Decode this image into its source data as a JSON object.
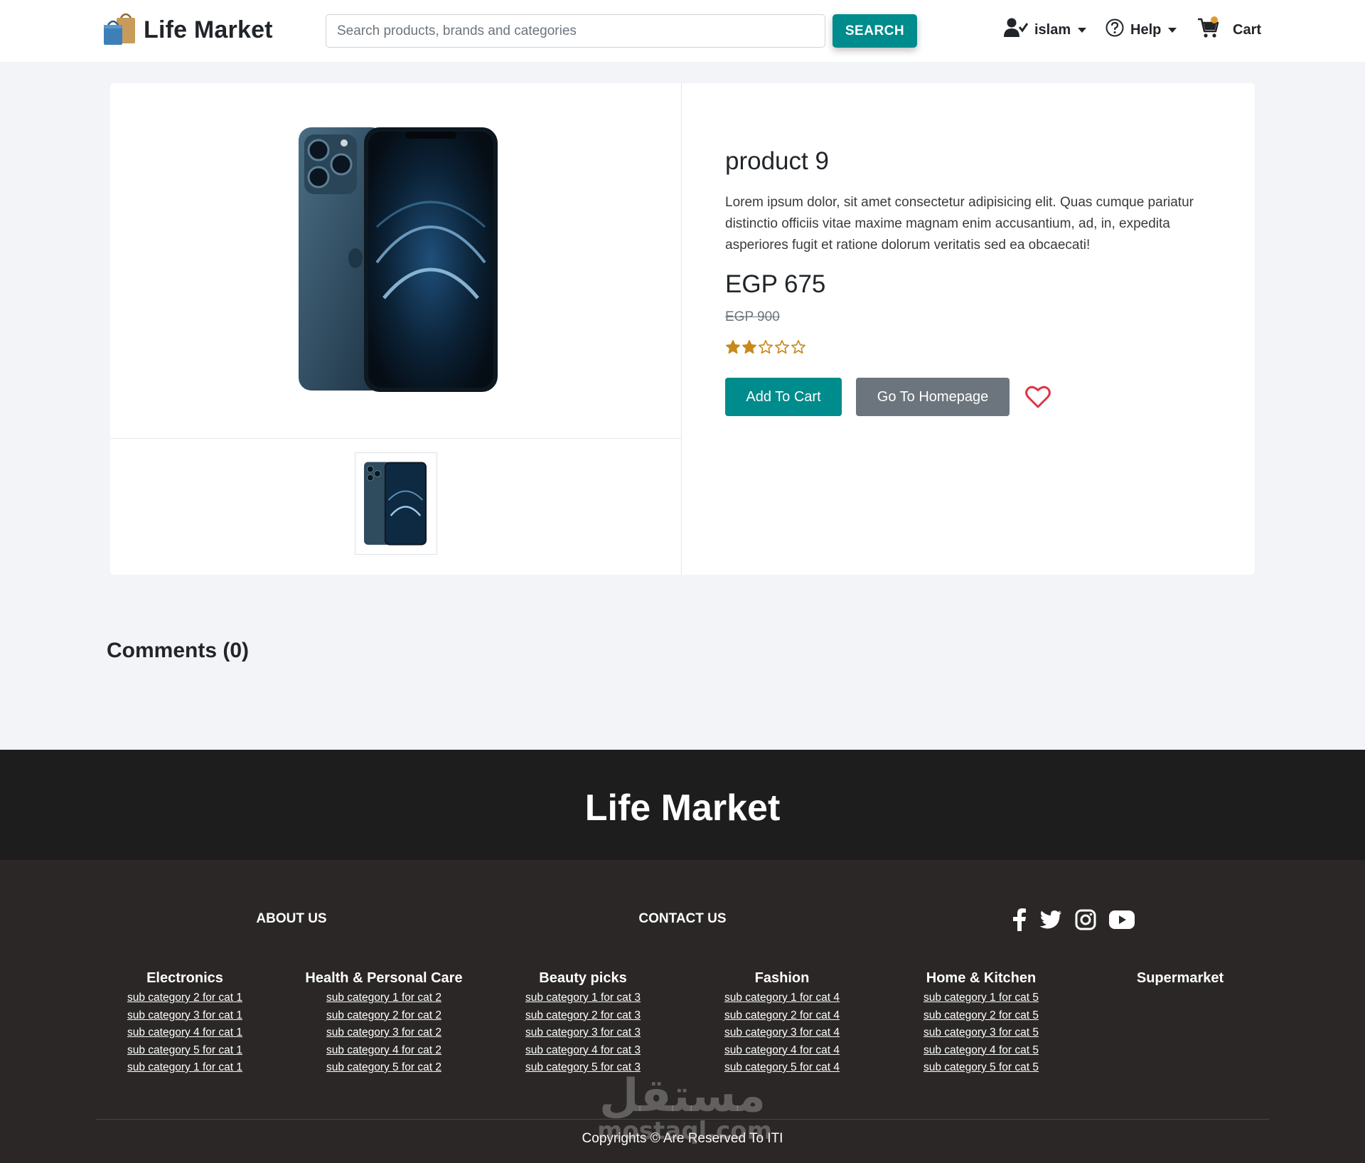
{
  "header": {
    "brand": "Life Market",
    "search_placeholder": "Search products, brands and categories",
    "search_button": "SEARCH",
    "user_name": "islam",
    "help_label": "Help",
    "cart_label": "Cart"
  },
  "product": {
    "title": "product 9",
    "description": "Lorem ipsum dolor, sit amet consectetur adipisicing elit. Quas cumque pariatur distinctio officiis vitae maxime magnam enim accusantium, ad, in, expedita asperiores fugit et ratione dolorum veritatis sed ea obcaecati!",
    "price": "EGP 675",
    "old_price": "EGP 900",
    "rating": 2,
    "rating_max": 5,
    "add_to_cart": "Add To Cart",
    "go_home": "Go To Homepage"
  },
  "comments": {
    "title": "Comments (0)"
  },
  "footer": {
    "brand": "Life Market",
    "about": "ABOUT US",
    "contact": "CONTACT US",
    "socials": [
      "facebook-icon",
      "twitter-icon",
      "instagram-icon",
      "youtube-icon"
    ],
    "categories": [
      {
        "title": "Electronics",
        "subs": [
          "sub category 2 for cat 1",
          "sub category 3 for cat 1",
          "sub category 4 for cat 1",
          "sub category 5 for cat 1",
          "sub category 1 for cat 1"
        ]
      },
      {
        "title": "Health & Personal Care",
        "subs": [
          "sub category 1 for cat 2",
          "sub category 2 for cat 2",
          "sub category 3 for cat 2",
          "sub category 4 for cat 2",
          "sub category 5 for cat 2"
        ]
      },
      {
        "title": "Beauty picks",
        "subs": [
          "sub category 1 for cat 3",
          "sub category 2 for cat 3",
          "sub category 3 for cat 3",
          "sub category 4 for cat 3",
          "sub category 5 for cat 3"
        ]
      },
      {
        "title": "Fashion",
        "subs": [
          "sub category 1 for cat 4",
          "sub category 2 for cat 4",
          "sub category 3 for cat 4",
          "sub category 4 for cat 4",
          "sub category 5 for cat 4"
        ]
      },
      {
        "title": "Home & Kitchen",
        "subs": [
          "sub category 1 for cat 5",
          "sub category 2 for cat 5",
          "sub category 3 for cat 5",
          "sub category 4 for cat 5",
          "sub category 5 for cat 5"
        ]
      },
      {
        "title": "Supermarket",
        "subs": []
      }
    ],
    "copyright": "Copyrights © Are Reserved To ITI"
  },
  "watermark": {
    "arabic": "مستقل",
    "latin": "mostaql.com"
  },
  "colors": {
    "accent": "#008c8c",
    "secondary_button": "#6c757d",
    "star": "#c88a1c",
    "heart": "#dc3545",
    "footer_top": "#1e1d1e",
    "footer_main": "#2b2727",
    "page_bg": "#f3f4f8"
  }
}
